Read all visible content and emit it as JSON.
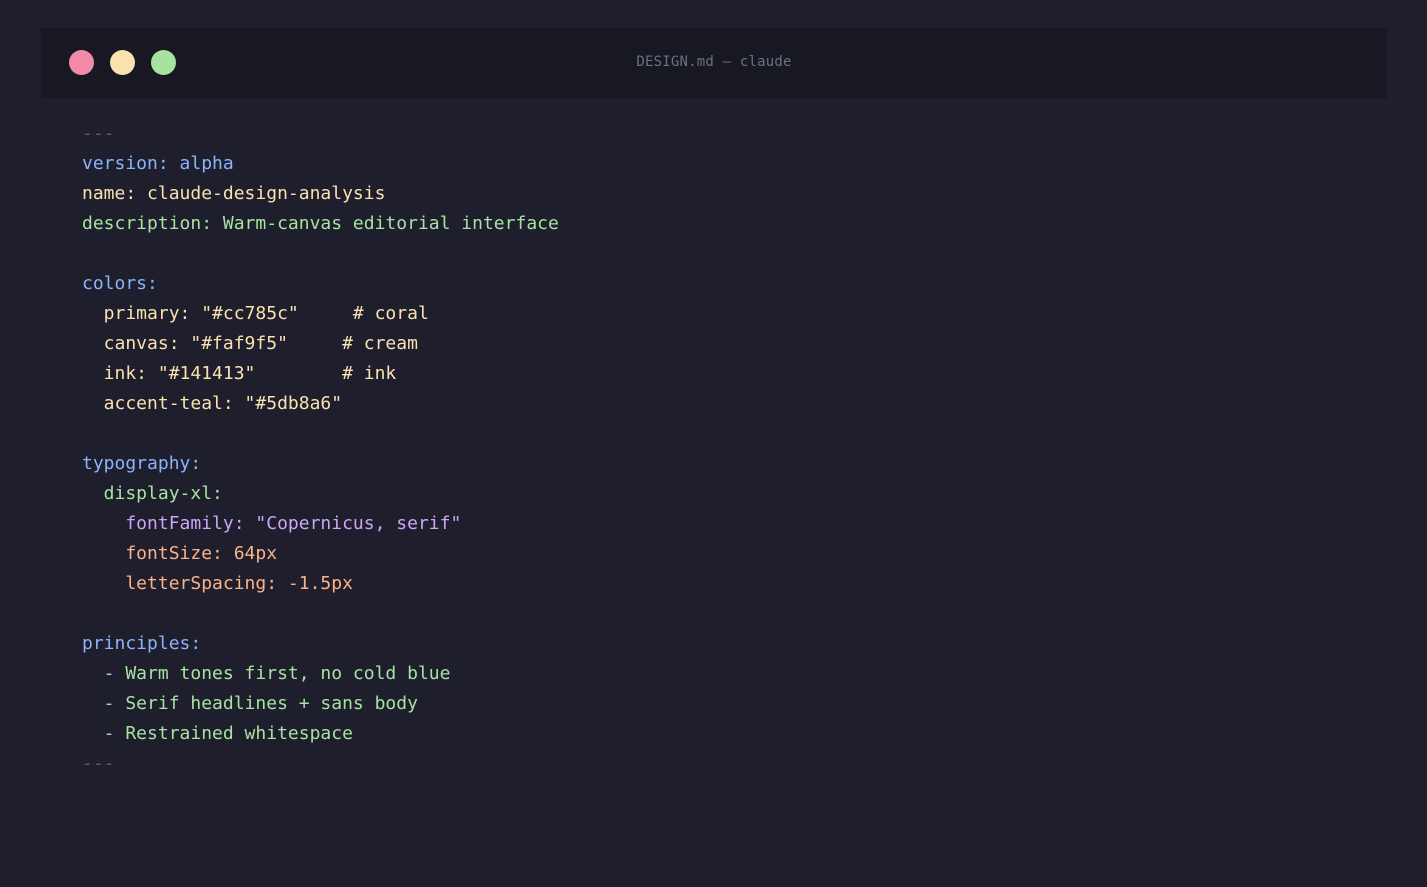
{
  "window": {
    "title": "DESIGN.md — claude",
    "controls": {
      "close_color": "#f38ba8",
      "minimize_color": "#f9e2af",
      "maximize_color": "#a6e3a1"
    }
  },
  "colors_theme": {
    "background": "#1f1e2d",
    "titlebar": "#181822"
  },
  "code": {
    "lines": [
      {
        "text": "---",
        "tone": "dash"
      },
      {
        "text": "version: alpha",
        "tone": "blue"
      },
      {
        "text": "name: claude-design-analysis",
        "tone": "yellow"
      },
      {
        "text": "description: Warm-canvas editorial interface",
        "tone": "green"
      },
      {
        "text": "",
        "tone": "blank"
      },
      {
        "text": "colors:",
        "tone": "blue"
      },
      {
        "text": "  primary: \"#cc785c\"     # coral",
        "tone": "yellow"
      },
      {
        "text": "  canvas: \"#faf9f5\"     # cream",
        "tone": "yellow"
      },
      {
        "text": "  ink: \"#141413\"        # ink",
        "tone": "yellow"
      },
      {
        "text": "  accent-teal: \"#5db8a6\"",
        "tone": "yellow"
      },
      {
        "text": "",
        "tone": "blank"
      },
      {
        "text": "typography:",
        "tone": "blue"
      },
      {
        "text": "  display-xl:",
        "tone": "green"
      },
      {
        "text": "    fontFamily: \"Copernicus, serif\"",
        "tone": "purple"
      },
      {
        "text": "    fontSize: 64px",
        "tone": "orange"
      },
      {
        "text": "    letterSpacing: -1.5px",
        "tone": "orange"
      },
      {
        "text": "",
        "tone": "blank"
      },
      {
        "text": "principles:",
        "tone": "blue"
      },
      {
        "text": "  - Warm tones first, no cold blue",
        "tone": "green"
      },
      {
        "text": "  - Serif headlines + sans body",
        "tone": "green"
      },
      {
        "text": "  - Restrained whitespace",
        "tone": "green"
      },
      {
        "text": "---",
        "tone": "dash"
      }
    ]
  }
}
